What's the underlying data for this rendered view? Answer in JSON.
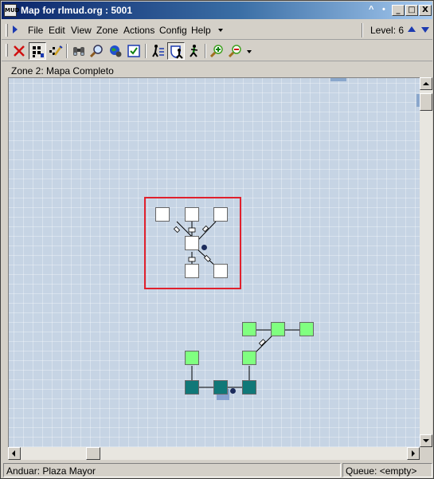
{
  "window": {
    "app_icon_text": "MUD",
    "title": "Map for rlmud.org : 5001",
    "extra_controls": [
      "^",
      "•"
    ],
    "controls": [
      "_",
      "□",
      "X"
    ]
  },
  "menubar": {
    "items": [
      "File",
      "Edit",
      "View",
      "Zone",
      "Actions",
      "Config",
      "Help"
    ],
    "level_label": "Level: 6"
  },
  "toolbar": {
    "buttons": [
      {
        "icon": "delete-icon"
      },
      {
        "icon": "auto-map-icon",
        "pressed": true
      },
      {
        "icon": "edit-icon"
      },
      {
        "icon": "binoculars-icon"
      },
      {
        "icon": "find-icon"
      },
      {
        "icon": "globe-icon"
      },
      {
        "icon": "check-icon"
      },
      {
        "icon": "walk-path-icon"
      },
      {
        "icon": "shield-walk-icon",
        "pressed": true
      },
      {
        "icon": "walker-icon"
      },
      {
        "icon": "zoom-in-icon"
      },
      {
        "icon": "zoom-out-icon"
      }
    ]
  },
  "zone_label": "Zone 2: Mapa Completo",
  "map": {
    "room_colors": {
      "white": "#ffffff",
      "lightgreen": "#80ff80",
      "teal": "#107878"
    },
    "highlight_color": "#e0202c"
  },
  "status": {
    "left": "Anduar: Plaza Mayor",
    "right": "Queue: <empty>"
  }
}
